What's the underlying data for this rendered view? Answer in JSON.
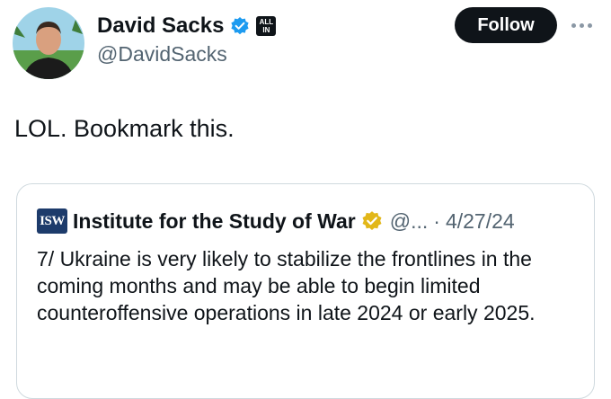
{
  "author": {
    "name": "David Sacks",
    "handle": "@DavidSacks",
    "affiliate_badge_text": "ALL IN"
  },
  "follow_button": {
    "label": "Follow"
  },
  "tweet": {
    "text": "LOL. Bookmark this."
  },
  "quoted_tweet": {
    "logo_text": "ISW",
    "name": "Institute for the Study of War",
    "handle": "@...",
    "separator": "·",
    "date": "4/27/24",
    "text": "7/ Ukraine is very likely to stabilize the frontlines in the coming months and may be able to begin limited counteroffensive operations in late 2024 or early 2025."
  },
  "icons": {
    "verified": "verified-badge-icon",
    "gold_verified": "gold-verified-badge-icon",
    "more": "more-options-icon"
  },
  "colors": {
    "verified_blue": "#1d9bf0",
    "gold": "#e2b719",
    "follow_bg": "#0f1419",
    "secondary_text": "#536471"
  }
}
